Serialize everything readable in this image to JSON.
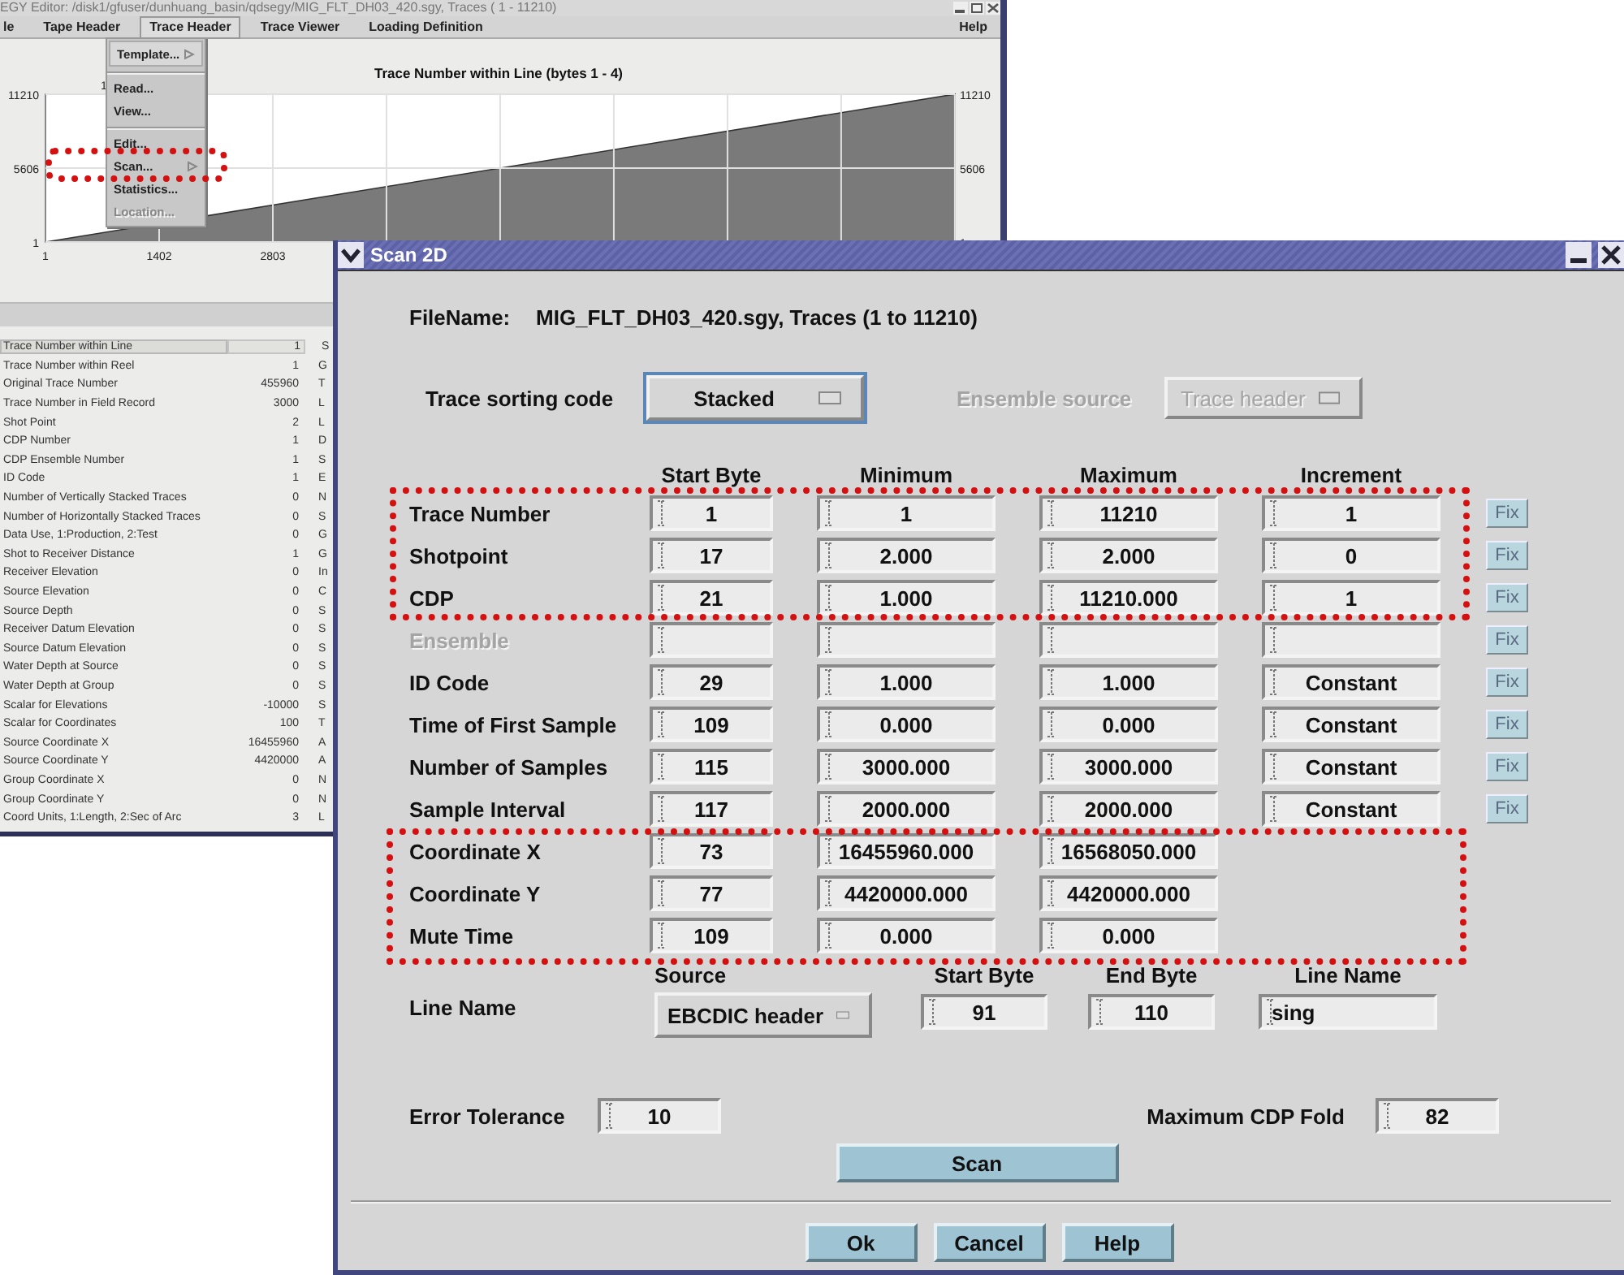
{
  "back_window": {
    "title": "EGY Editor: /disk1/gfuser/dunhuang_basin/qdsegy/MIG_FLT_DH03_420.sgy, Traces ( 1 - 11210)",
    "menu": [
      {
        "label": "le",
        "selected": false
      },
      {
        "label": "Tape Header",
        "selected": false
      },
      {
        "label": "Trace Header",
        "selected": true
      },
      {
        "label": "Trace Viewer",
        "selected": false
      },
      {
        "label": "Loading Definition",
        "selected": false
      },
      {
        "label": "Help",
        "selected": false
      }
    ],
    "dropdown": [
      {
        "label": "Template...",
        "kind": "cascade",
        "separator_before": false,
        "disabled": false,
        "highlighted": false
      },
      {
        "label": "Read...",
        "kind": "command",
        "separator_before": true,
        "disabled": false,
        "highlighted": false
      },
      {
        "label": "View...",
        "kind": "command",
        "separator_before": false,
        "disabled": false,
        "highlighted": false
      },
      {
        "label": "Edit...",
        "kind": "command",
        "separator_before": true,
        "disabled": false,
        "highlighted": false
      },
      {
        "label": "Scan...",
        "kind": "cascade",
        "separator_before": false,
        "disabled": false,
        "highlighted": true
      },
      {
        "label": "Statistics...",
        "kind": "command",
        "separator_before": false,
        "disabled": false,
        "highlighted": false
      },
      {
        "label": "Location...",
        "kind": "command",
        "separator_before": false,
        "disabled": true,
        "highlighted": false
      }
    ],
    "chart": {
      "corner_label": "1",
      "left_axis_labels": [
        "11210",
        "5606",
        "1"
      ],
      "chart_data": {
        "type": "area",
        "grid": true,
        "title": "Trace Number within Line  (bytes 1 - 4)",
        "x": [
          1,
          11210
        ],
        "series": [
          {
            "color": "#7a7a7a",
            "values": [
              1,
              11210
            ]
          }
        ],
        "xlim": [
          1,
          11210
        ],
        "ylim": [
          1,
          11210
        ],
        "xticks": [
          1,
          1402,
          2803
        ],
        "yticks": [
          1,
          5606,
          11210
        ]
      }
    },
    "list": [
      {
        "name": "Trace Number within Line",
        "value": "1",
        "column_3": "S",
        "selected": true
      },
      {
        "name": "Trace Number within Reel",
        "value": "1",
        "column_3": "G",
        "selected": false
      },
      {
        "name": "Original Trace Number",
        "value": "455960",
        "column_3": "T",
        "selected": false
      },
      {
        "name": "Trace Number in Field Record",
        "value": "3000",
        "column_3": "L",
        "selected": false
      },
      {
        "name": "Shot Point",
        "value": "2",
        "column_3": "L",
        "selected": false
      },
      {
        "name": "CDP Number",
        "value": "1",
        "column_3": "D",
        "selected": false
      },
      {
        "name": "CDP Ensemble Number",
        "value": "1",
        "column_3": "S",
        "selected": false
      },
      {
        "name": "ID Code",
        "value": "1",
        "column_3": "E",
        "selected": false
      },
      {
        "name": "Number of Vertically Stacked Traces",
        "value": "0",
        "column_3": "N",
        "selected": false
      },
      {
        "name": "Number of Horizontally Stacked Traces",
        "value": "0",
        "column_3": "S",
        "selected": false
      },
      {
        "name": "Data Use, 1:Production, 2:Test",
        "value": "0",
        "column_3": "G",
        "selected": false
      },
      {
        "name": "Shot to Receiver Distance",
        "value": "1",
        "column_3": "G",
        "selected": false
      },
      {
        "name": "Receiver Elevation",
        "value": "0",
        "column_3": "In",
        "selected": false
      },
      {
        "name": "Source Elevation",
        "value": "0",
        "column_3": "C",
        "selected": false
      },
      {
        "name": "Source Depth",
        "value": "0",
        "column_3": "S",
        "selected": false
      },
      {
        "name": "Receiver Datum Elevation",
        "value": "0",
        "column_3": "S",
        "selected": false
      },
      {
        "name": "Source Datum Elevation",
        "value": "0",
        "column_3": "S",
        "selected": false
      },
      {
        "name": "Water Depth at Source",
        "value": "0",
        "column_3": "S",
        "selected": false
      },
      {
        "name": "Water Depth at Group",
        "value": "0",
        "column_3": "S",
        "selected": false
      },
      {
        "name": "Scalar for Elevations",
        "value": "-10000",
        "column_3": "S",
        "selected": false
      },
      {
        "name": "Scalar for Coordinates",
        "value": "100",
        "column_3": "T",
        "selected": false
      },
      {
        "name": "Source Coordinate X",
        "value": "16455960",
        "column_3": "A",
        "selected": false
      },
      {
        "name": "Source Coordinate Y",
        "value": "4420000",
        "column_3": "A",
        "selected": false
      },
      {
        "name": "Group Coordinate X",
        "value": "0",
        "column_3": "N",
        "selected": false
      },
      {
        "name": "Group Coordinate Y",
        "value": "0",
        "column_3": "N",
        "selected": false
      },
      {
        "name": "Coord Units, 1:Length, 2:Sec of Arc",
        "value": "3",
        "column_3": "L",
        "selected": false
      }
    ]
  },
  "dialog": {
    "title": "Scan 2D",
    "file_label": "FileName:",
    "file_value": "MIG_FLT_DH03_420.sgy, Traces (1 to 11210)",
    "sorting": {
      "label": "Trace sorting code",
      "value": "Stacked",
      "focused": true,
      "disabled": false
    },
    "ensemble_source": {
      "label": "Ensemble source",
      "value": "Trace header",
      "focused": false,
      "disabled": true
    },
    "columns": [
      "Start Byte",
      "Minimum",
      "Maximum",
      "Increment"
    ],
    "rows": [
      {
        "kind": "full",
        "label": "Trace Number",
        "start_byte": "1",
        "minimum": "1",
        "maximum": "11210",
        "increment": "1",
        "fix": "Fix",
        "disabled": false,
        "highlighted": true
      },
      {
        "kind": "full",
        "label": "Shotpoint",
        "start_byte": "17",
        "minimum": "2.000",
        "maximum": "2.000",
        "increment": "0",
        "fix": "Fix",
        "disabled": false,
        "highlighted": true
      },
      {
        "kind": "full",
        "label": "CDP",
        "start_byte": "21",
        "minimum": "1.000",
        "maximum": "11210.000",
        "increment": "1",
        "fix": "Fix",
        "disabled": false,
        "highlighted": true
      },
      {
        "kind": "full",
        "label": "Ensemble",
        "fix": "Fix",
        "disabled": true,
        "highlighted": false
      },
      {
        "kind": "full",
        "label": "ID Code",
        "start_byte": "29",
        "minimum": "1.000",
        "maximum": "1.000",
        "increment": "Constant",
        "fix": "Fix",
        "disabled": false,
        "highlighted": false
      },
      {
        "kind": "full",
        "label": "Time of First Sample",
        "start_byte": "109",
        "minimum": "0.000",
        "maximum": "0.000",
        "increment": "Constant",
        "fix": "Fix",
        "disabled": false,
        "highlighted": false
      },
      {
        "kind": "full",
        "label": "Number of Samples",
        "start_byte": "115",
        "minimum": "3000.000",
        "maximum": "3000.000",
        "increment": "Constant",
        "fix": "Fix",
        "disabled": false,
        "highlighted": false
      },
      {
        "kind": "full",
        "label": "Sample Interval",
        "start_byte": "117",
        "minimum": "2000.000",
        "maximum": "2000.000",
        "increment": "Constant",
        "fix": "Fix",
        "disabled": false,
        "highlighted": false
      },
      {
        "kind": "range",
        "label": "Coordinate X",
        "start_byte": "73",
        "minimum": "16455960.000",
        "maximum": "16568050.000",
        "disabled": false,
        "highlighted": true
      },
      {
        "kind": "range",
        "label": "Coordinate Y",
        "start_byte": "77",
        "minimum": "4420000.000",
        "maximum": "4420000.000",
        "disabled": false,
        "highlighted": true
      },
      {
        "kind": "range",
        "label": "Mute Time",
        "start_byte": "109",
        "minimum": "0.000",
        "maximum": "0.000",
        "disabled": false,
        "highlighted": true
      }
    ],
    "line_name": {
      "label": "Line Name",
      "columns": [
        "Source",
        "Start Byte",
        "End Byte",
        "Line Name"
      ],
      "source": "EBCDIC header",
      "start_byte": "91",
      "end_byte": "110",
      "line_name": "sing"
    },
    "error_tolerance": {
      "label": "Error Tolerance",
      "value": "10"
    },
    "max_cdp_fold": {
      "label": "Maximum CDP Fold",
      "value": "82"
    },
    "scan_button": "Scan",
    "buttons": [
      "Ok",
      "Cancel",
      "Help"
    ]
  }
}
